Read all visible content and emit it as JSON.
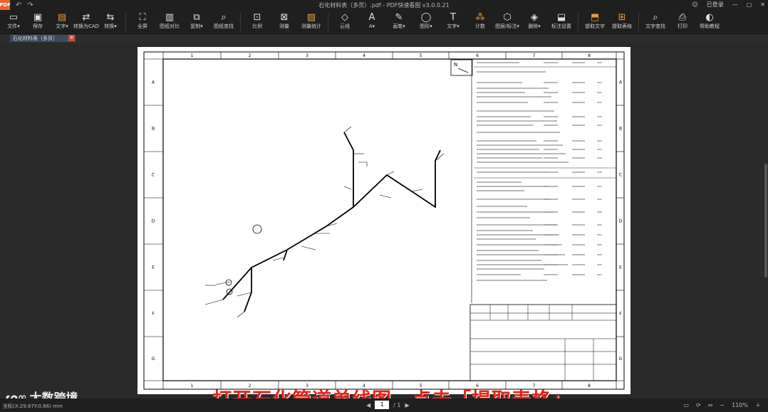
{
  "app": {
    "logo_text": "PDF",
    "window_title": "石化材料表（多页）.pdf - PDF快速看图 v3.0.0.21",
    "login_label": "已登录",
    "accent": "#e8632a"
  },
  "toolbar": {
    "items": [
      {
        "icon": "folder-icon",
        "glyph": "▭",
        "label": "文件▾",
        "orange": false
      },
      {
        "icon": "save-icon",
        "glyph": "▣",
        "label": "保存",
        "orange": false
      },
      {
        "icon": "page-icon",
        "glyph": "▤",
        "label": "文字▾",
        "orange": true
      },
      {
        "icon": "convert-icon",
        "glyph": "⇄",
        "label": "转换为CAD",
        "orange": false
      },
      {
        "icon": "convert2-icon",
        "glyph": "⇆",
        "label": "转换▾",
        "orange": false
      },
      {
        "icon": "fullscreen-icon",
        "glyph": "⛶",
        "label": "全屏",
        "orange": false
      },
      {
        "icon": "merge-icon",
        "glyph": "▥",
        "label": "图纸对比",
        "orange": false
      },
      {
        "icon": "copy-icon",
        "glyph": "⧉",
        "label": "复制▾",
        "orange": false
      },
      {
        "icon": "search-icon",
        "glyph": "⌕",
        "label": "图纸查找",
        "orange": false
      },
      {
        "icon": "ratio-icon",
        "glyph": "⊡",
        "label": "比例",
        "orange": false
      },
      {
        "icon": "measure-icon",
        "glyph": "⊠",
        "label": "测量",
        "orange": false
      },
      {
        "icon": "measure-stat-icon",
        "glyph": "▨",
        "label": "测量统计",
        "orange": true
      },
      {
        "icon": "cloud-line-icon",
        "glyph": "◇",
        "label": "云线",
        "orange": false
      },
      {
        "icon": "text-icon",
        "glyph": "A",
        "label": "A▾",
        "orange": false
      },
      {
        "icon": "pen-icon",
        "glyph": "✎",
        "label": "画笔▾",
        "orange": false
      },
      {
        "icon": "shape-icon",
        "glyph": "◯",
        "label": "图形▾",
        "orange": false
      },
      {
        "icon": "text-note-icon",
        "glyph": "T",
        "label": "文字▾",
        "orange": false
      },
      {
        "icon": "count-icon",
        "glyph": "⁂",
        "label": "计数",
        "orange": true
      },
      {
        "icon": "layer-icon",
        "glyph": "⬡",
        "label": "图层/标注▾",
        "orange": false
      },
      {
        "icon": "erase-icon",
        "glyph": "◈",
        "label": "删除▾",
        "orange": false
      },
      {
        "icon": "stamp-icon",
        "glyph": "⬓",
        "label": "标注设置",
        "orange": false
      },
      {
        "icon": "extract-text-icon",
        "glyph": "⬒",
        "label": "提取文字",
        "orange": true
      },
      {
        "icon": "extract-table-icon",
        "glyph": "⊞",
        "label": "提取表格",
        "orange": true
      },
      {
        "icon": "text-search-icon",
        "glyph": "⌕",
        "label": "文字查找",
        "orange": false
      },
      {
        "icon": "print-icon",
        "glyph": "⎙",
        "label": "打印",
        "orange": false
      },
      {
        "icon": "help-icon",
        "glyph": "◐",
        "label": "帮助教程",
        "orange": false
      }
    ]
  },
  "tabs": {
    "doc_tab_label": "石化材料表（多页）",
    "close_glyph": "✕"
  },
  "drawing": {
    "col_labels": [
      "1",
      "2",
      "3",
      "4",
      "5",
      "6",
      "7",
      "8"
    ],
    "row_labels": [
      "A",
      "B",
      "C",
      "D",
      "E",
      "F",
      "G"
    ],
    "north": "N"
  },
  "caption": "打开石化管道单线图，点击「提取表格」",
  "watermark": "大数跨境",
  "status": {
    "coords": "坐标(X:29.67Y:0.86) mm",
    "page_current": "1",
    "page_total": "/ 1",
    "zoom": "110%"
  }
}
